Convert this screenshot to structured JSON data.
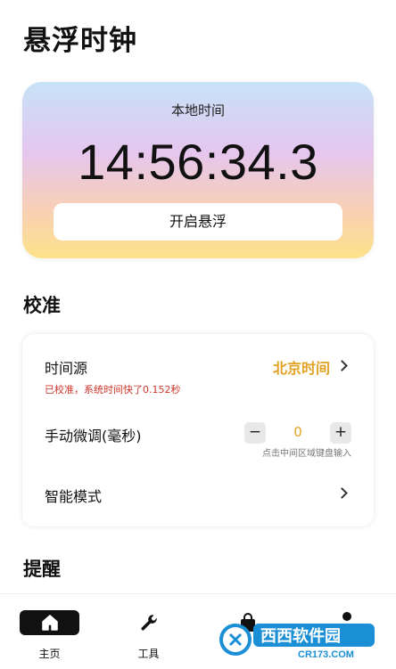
{
  "app": {
    "title": "悬浮时钟"
  },
  "clock": {
    "label": "本地时间",
    "time": "14:56:34.3",
    "float_button": "开启悬浮"
  },
  "sections": {
    "calibration": "校准",
    "reminders": "提醒"
  },
  "calibration": {
    "time_source_label": "时间源",
    "time_source_value": "北京时间",
    "status": "已校准，系统时间快了0.152秒",
    "manual_label": "手动微调(毫秒)",
    "manual_value": "0",
    "manual_hint": "点击中间区域键盘输入",
    "smart_mode_label": "智能模式"
  },
  "nav": {
    "items": [
      {
        "label": "主页",
        "icon": "home-icon",
        "active": true
      },
      {
        "label": "工具",
        "icon": "wrench-icon"
      },
      {
        "label": "",
        "icon": "bag-icon"
      },
      {
        "label": "",
        "icon": "person-icon"
      }
    ]
  },
  "watermark": {
    "brand": "西西软件园",
    "site": "CR173.COM"
  },
  "colors": {
    "accent": "#e2a324",
    "status_red": "#d0352b",
    "text": "#111111"
  }
}
